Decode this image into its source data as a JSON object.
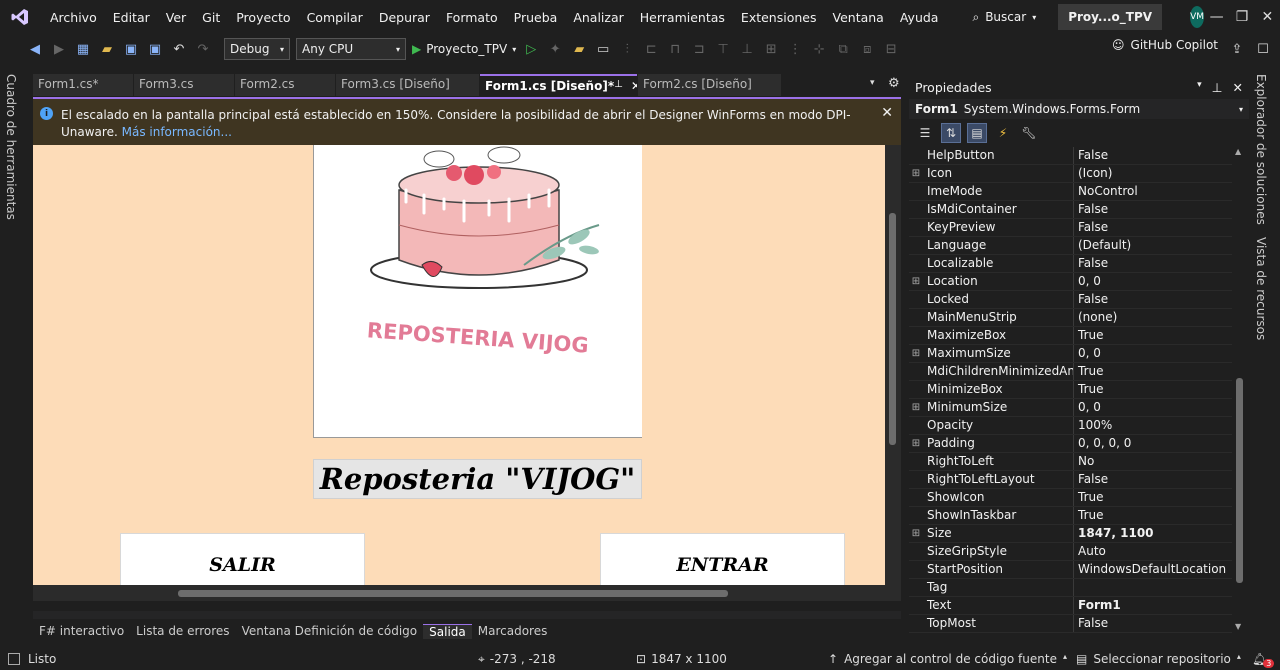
{
  "menubar": {
    "items": [
      "Archivo",
      "Editar",
      "Ver",
      "Git",
      "Proyecto",
      "Compilar",
      "Depurar",
      "Formato",
      "Prueba",
      "Analizar",
      "Herramientas",
      "Extensiones",
      "Ventana",
      "Ayuda"
    ],
    "search_label": "Buscar",
    "solution_name": "Proy...o_TPV",
    "avatar_initials": "VM"
  },
  "toolbar": {
    "config": "Debug",
    "platform": "Any CPU",
    "start_label": "Proyecto_TPV",
    "copilot_label": "GitHub Copilot"
  },
  "left_tab": "Cuadro de herramientas",
  "doc_tabs": [
    "Form1.cs*",
    "Form3.cs",
    "Form2.cs",
    "Form3.cs [Diseño]",
    "Form1.cs [Diseño]*",
    "Form2.cs [Diseño]"
  ],
  "active_tab_index": 4,
  "infobar": {
    "text": "El escalado en la pantalla principal está establecido en 150%. Considere la posibilidad de abrir el Designer WinForms en modo DPI-Unaware.",
    "link": "Más información..."
  },
  "designer": {
    "logo_text": "REPOSTERIA VIJOG",
    "title_label": "Reposteria \"VIJOG\"",
    "btn_exit": "SALIR",
    "btn_enter": "ENTRAR"
  },
  "bottom_tabs": [
    "F# interactivo",
    "Lista de errores",
    "Ventana Definición de código",
    "Salida",
    "Marcadores"
  ],
  "active_bottom_tab": 3,
  "properties": {
    "title": "Propiedades",
    "object_name": "Form1",
    "object_type": "System.Windows.Forms.Form",
    "rows": [
      {
        "name": "HelpButton",
        "value": "False",
        "exp": false,
        "bold": false
      },
      {
        "name": "Icon",
        "value": "(Icon)",
        "exp": true,
        "bold": false
      },
      {
        "name": "ImeMode",
        "value": "NoControl",
        "exp": false,
        "bold": false
      },
      {
        "name": "IsMdiContainer",
        "value": "False",
        "exp": false,
        "bold": false
      },
      {
        "name": "KeyPreview",
        "value": "False",
        "exp": false,
        "bold": false
      },
      {
        "name": "Language",
        "value": "(Default)",
        "exp": false,
        "bold": false
      },
      {
        "name": "Localizable",
        "value": "False",
        "exp": false,
        "bold": false
      },
      {
        "name": "Location",
        "value": "0, 0",
        "exp": true,
        "bold": false
      },
      {
        "name": "Locked",
        "value": "False",
        "exp": false,
        "bold": false
      },
      {
        "name": "MainMenuStrip",
        "value": "(none)",
        "exp": false,
        "bold": false
      },
      {
        "name": "MaximizeBox",
        "value": "True",
        "exp": false,
        "bold": false
      },
      {
        "name": "MaximumSize",
        "value": "0, 0",
        "exp": true,
        "bold": false
      },
      {
        "name": "MdiChildrenMinimizedAnch",
        "value": "True",
        "exp": false,
        "bold": false
      },
      {
        "name": "MinimizeBox",
        "value": "True",
        "exp": false,
        "bold": false
      },
      {
        "name": "MinimumSize",
        "value": "0, 0",
        "exp": true,
        "bold": false
      },
      {
        "name": "Opacity",
        "value": "100%",
        "exp": false,
        "bold": false
      },
      {
        "name": "Padding",
        "value": "0, 0, 0, 0",
        "exp": true,
        "bold": false
      },
      {
        "name": "RightToLeft",
        "value": "No",
        "exp": false,
        "bold": false
      },
      {
        "name": "RightToLeftLayout",
        "value": "False",
        "exp": false,
        "bold": false
      },
      {
        "name": "ShowIcon",
        "value": "True",
        "exp": false,
        "bold": false
      },
      {
        "name": "ShowInTaskbar",
        "value": "True",
        "exp": false,
        "bold": false
      },
      {
        "name": "Size",
        "value": "1847, 1100",
        "exp": true,
        "bold": true
      },
      {
        "name": "SizeGripStyle",
        "value": "Auto",
        "exp": false,
        "bold": false
      },
      {
        "name": "StartPosition",
        "value": "WindowsDefaultLocation",
        "exp": false,
        "bold": false
      },
      {
        "name": "Tag",
        "value": "",
        "exp": false,
        "bold": false
      },
      {
        "name": "Text",
        "value": "Form1",
        "exp": false,
        "bold": true
      },
      {
        "name": "TopMost",
        "value": "False",
        "exp": false,
        "bold": false
      }
    ]
  },
  "right_tabs": [
    "Explorador de soluciones",
    "Vista de recursos"
  ],
  "statusbar": {
    "ready": "Listo",
    "position": "-273 , -218",
    "size": "1847 x 1100",
    "add_source": "Agregar al control de código fuente",
    "select_repo": "Seleccionar repositorio",
    "notif_count": "3"
  }
}
